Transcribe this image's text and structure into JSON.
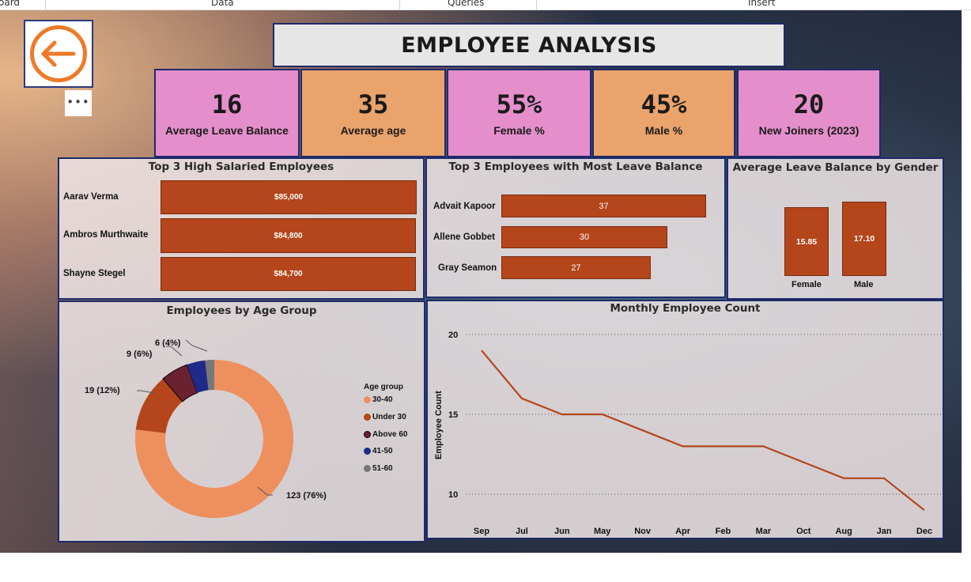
{
  "menu": {
    "tabs": [
      "oard",
      "Data",
      "Queries",
      "Insert"
    ]
  },
  "header": {
    "title": "EMPLOYEE ANALYSIS",
    "back_icon": "arrow-left-icon",
    "more_label": "•••"
  },
  "kpis": [
    {
      "value": "16",
      "label": "Average Leave Balance",
      "color": "#e48fcb"
    },
    {
      "value": "35",
      "label": "Average age",
      "color": "#eba36c"
    },
    {
      "value": "55%",
      "label": "Female %",
      "color": "#e48fcb"
    },
    {
      "value": "45%",
      "label": "Male %",
      "color": "#eba36c"
    },
    {
      "value": "20",
      "label": "New Joiners (2023)",
      "color": "#e48fcb"
    }
  ],
  "colors": {
    "bar": "#b5451b",
    "line": "#b5451b",
    "panel_border": "#1e2a6a"
  },
  "salaried": {
    "title": "Top 3 High Salaried Employees",
    "rows": [
      {
        "name": "Aarav Verma",
        "label": "$85,000",
        "value": 85000
      },
      {
        "name": "Ambros Murthwaite",
        "label": "$84,800",
        "value": 84800
      },
      {
        "name": "Shayne Stegel",
        "label": "$84,700",
        "value": 84700
      }
    ]
  },
  "leave": {
    "title": "Top 3 Employees with Most Leave Balance",
    "rows": [
      {
        "name": "Advait Kapoor",
        "label": "37",
        "value": 37
      },
      {
        "name": "Allene Gobbet",
        "label": "30",
        "value": 30
      },
      {
        "name": "Gray Seamon",
        "label": "27",
        "value": 27
      }
    ]
  },
  "gender": {
    "title": "Average Leave Balance by Gender",
    "rows": [
      {
        "name": "Female",
        "label": "15.85",
        "value": 15.85
      },
      {
        "name": "Male",
        "label": "17.10",
        "value": 17.1
      }
    ]
  },
  "age": {
    "title": "Employees by Age Group",
    "legend_title": "Age group",
    "slices": [
      {
        "name": "30-40",
        "value": 123,
        "label": "123 (76%)",
        "color": "#ee8f5e"
      },
      {
        "name": "Under 30",
        "value": 19,
        "label": "19 (12%)",
        "color": "#b5451b"
      },
      {
        "name": "Above 60",
        "value": 9,
        "label": "9 (6%)",
        "color": "#6a2230"
      },
      {
        "name": "41-50",
        "value": 6,
        "label": "6 (4%)",
        "color": "#1f2a8a"
      },
      {
        "name": "51-60",
        "value": 3,
        "label": "",
        "color": "#777777"
      }
    ]
  },
  "monthly": {
    "title": "Monthly Employee Count",
    "ylabel": "Employee Count",
    "yticks": [
      "20",
      "15",
      "10"
    ]
  },
  "chart_data": [
    {
      "type": "bar",
      "title": "Top 3 High Salaried Employees",
      "categories": [
        "Aarav Verma",
        "Ambros Murthwaite",
        "Shayne Stegel"
      ],
      "values": [
        85000,
        84800,
        84700
      ]
    },
    {
      "type": "bar",
      "title": "Top 3 Employees with Most Leave Balance",
      "categories": [
        "Advait Kapoor",
        "Allene Gobbet",
        "Gray Seamon"
      ],
      "values": [
        37,
        30,
        27
      ]
    },
    {
      "type": "bar",
      "title": "Average Leave Balance by Gender",
      "categories": [
        "Female",
        "Male"
      ],
      "values": [
        15.85,
        17.1
      ]
    },
    {
      "type": "pie",
      "title": "Employees by Age Group",
      "categories": [
        "30-40",
        "Under 30",
        "Above 60",
        "41-50",
        "51-60"
      ],
      "values": [
        123,
        19,
        9,
        6,
        3
      ]
    },
    {
      "type": "line",
      "title": "Monthly Employee Count",
      "xlabel": "",
      "ylabel": "Employee Count",
      "categories": [
        "Sep",
        "Jul",
        "Jun",
        "May",
        "Nov",
        "Apr",
        "Feb",
        "Mar",
        "Oct",
        "Aug",
        "Jan",
        "Dec"
      ],
      "values": [
        19,
        16,
        15,
        15,
        14,
        13,
        13,
        13,
        12,
        11,
        11,
        9
      ],
      "ylim": [
        7.5,
        20
      ],
      "grid": true
    }
  ]
}
